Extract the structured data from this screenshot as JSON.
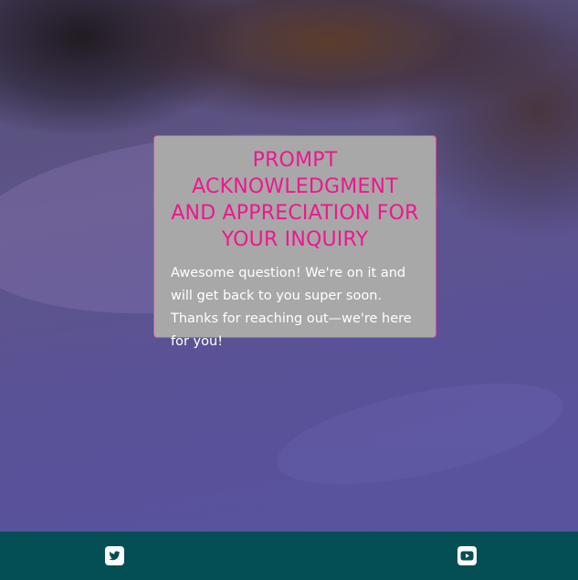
{
  "card": {
    "title": "PROMPT ACKNOWLEDGMENT AND APPRECIATION FOR YOUR INQUIRY",
    "message": "Awesome question! We're on it and will get back to you super soon. Thanks for reaching out—we're here for you!"
  },
  "footer": {
    "links": [
      {
        "icon": "twitter-icon"
      },
      {
        "icon": "youtube-icon"
      }
    ]
  },
  "colors": {
    "title": "#f0168e",
    "card_border": "#e8479a",
    "card_background": "#a8a8a8",
    "footer_background": "#034f55"
  }
}
